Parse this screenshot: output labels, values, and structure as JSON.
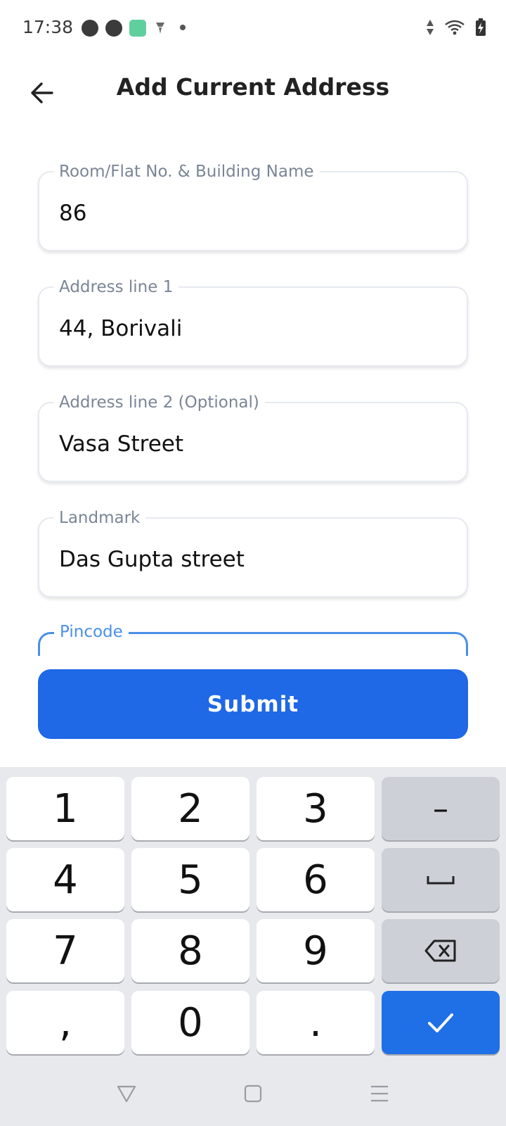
{
  "status_bar": {
    "time": "17:38",
    "notification_icons": [
      "app-icon",
      "chat-icon",
      "app-green-icon",
      "vpn-icon",
      "dot-icon"
    ],
    "right_icons": [
      "data-arrows-icon",
      "wifi-icon",
      "battery-charging-icon"
    ]
  },
  "header": {
    "title": "Add Current Address",
    "back_icon": "back-arrow-icon"
  },
  "form": {
    "fields": [
      {
        "label": "Room/Flat No. & Building Name",
        "value": "86"
      },
      {
        "label": "Address line 1",
        "value": "44, Borivali"
      },
      {
        "label": "Address line 2 (Optional)",
        "value": "Vasa Street"
      },
      {
        "label": "Landmark",
        "value": "Das Gupta street"
      },
      {
        "label": "Pincode",
        "value": ""
      }
    ],
    "submit_label": "Submit",
    "colors": {
      "accent": "#1f68e6",
      "focus": "#4a8fe8",
      "label": "#7a8597"
    }
  },
  "keyboard": {
    "keys": [
      [
        "1",
        "2",
        "3",
        "–"
      ],
      [
        "4",
        "5",
        "6",
        "space-icon"
      ],
      [
        "7",
        "8",
        "9",
        "backspace-icon"
      ],
      [
        ",",
        "0",
        ".",
        "done-check-icon"
      ]
    ]
  },
  "nav_bar": {
    "buttons": [
      "back-triangle-icon",
      "home-square-icon",
      "menu-lines-icon"
    ]
  }
}
